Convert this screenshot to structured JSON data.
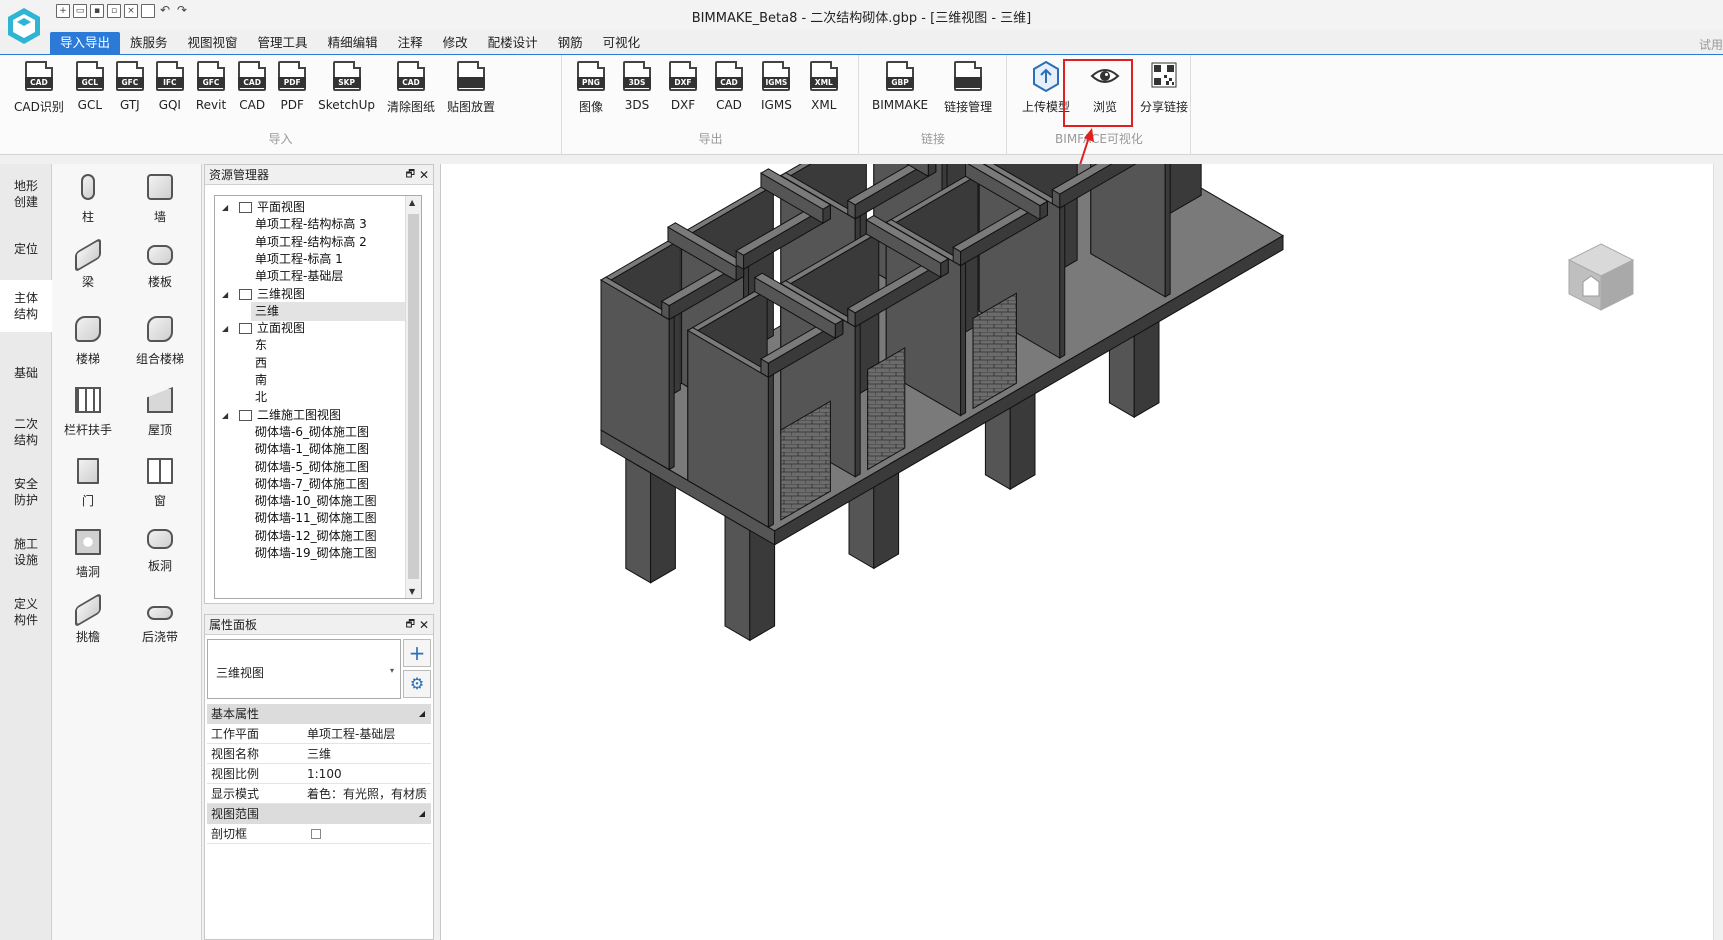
{
  "window": {
    "title": "BIMMAKE_Beta8 - 二次结构砌体.gbp - [三维视图 - 三维]",
    "trial": "试用"
  },
  "ribbon_tabs": [
    "导入导出",
    "族服务",
    "视图视窗",
    "管理工具",
    "精细编辑",
    "注释",
    "修改",
    "配楼设计",
    "钢筋",
    "可视化"
  ],
  "ribbon": {
    "import": {
      "title": "导入",
      "buttons": [
        {
          "label": "CAD识别",
          "tag": "CAD"
        },
        {
          "label": "GCL",
          "tag": "GCL"
        },
        {
          "label": "GTJ",
          "tag": "GFC"
        },
        {
          "label": "GQI",
          "tag": "IFC"
        },
        {
          "label": "Revit",
          "tag": "GFC"
        },
        {
          "label": "CAD",
          "tag": "CAD"
        },
        {
          "label": "PDF",
          "tag": "PDF"
        },
        {
          "label": "SketchUp",
          "tag": "SKP"
        },
        {
          "label": "清除图纸",
          "tag": "CAD"
        },
        {
          "label": "贴图放置",
          "tag": ""
        }
      ]
    },
    "export": {
      "title": "导出",
      "buttons": [
        {
          "label": "图像",
          "tag": "PNG"
        },
        {
          "label": "3DS",
          "tag": "3DS"
        },
        {
          "label": "DXF",
          "tag": "DXF"
        },
        {
          "label": "CAD",
          "tag": "CAD"
        },
        {
          "label": "IGMS",
          "tag": "IGMS"
        },
        {
          "label": "XML",
          "tag": "XML"
        }
      ]
    },
    "link": {
      "title": "链接",
      "buttons": [
        {
          "label": "BIMMAKE",
          "tag": "GBP"
        },
        {
          "label": "链接管理",
          "tag": ""
        }
      ]
    },
    "bimface": {
      "title": "BIMFACE可视化",
      "buttons": [
        {
          "label": "上传模型",
          "tag": ""
        },
        {
          "label": "浏览",
          "tag": ""
        },
        {
          "label": "分享链接",
          "tag": ""
        }
      ]
    }
  },
  "left_rail": [
    "地形创建",
    "定位",
    "主体结构",
    "基础",
    "二次结构",
    "安全防护",
    "施工设施",
    "定义构件"
  ],
  "palette": [
    "柱",
    "墙",
    "梁",
    "楼板",
    "楼梯",
    "组合楼梯",
    "栏杆扶手",
    "屋顶",
    "门",
    "窗",
    "墙洞",
    "板洞",
    "挑檐",
    "后浇带"
  ],
  "resource_manager": {
    "title": "资源管理器",
    "tree": [
      {
        "label": "平面视图",
        "level": 0
      },
      {
        "label": "单项工程-结构标高 3",
        "level": 1
      },
      {
        "label": "单项工程-结构标高 2",
        "level": 1
      },
      {
        "label": "单项工程-标高 1",
        "level": 1
      },
      {
        "label": "单项工程-基础层",
        "level": 1
      },
      {
        "label": "三维视图",
        "level": 0
      },
      {
        "label": "三维",
        "level": 1,
        "selected": true
      },
      {
        "label": "立面视图",
        "level": 0
      },
      {
        "label": "东",
        "level": 1
      },
      {
        "label": "西",
        "level": 1
      },
      {
        "label": "南",
        "level": 1
      },
      {
        "label": "北",
        "level": 1
      },
      {
        "label": "二维施工图视图",
        "level": 0
      },
      {
        "label": "砌体墙-6_砌体施工图",
        "level": 1
      },
      {
        "label": "砌体墙-1_砌体施工图",
        "level": 1
      },
      {
        "label": "砌体墙-5_砌体施工图",
        "level": 1
      },
      {
        "label": "砌体墙-7_砌体施工图",
        "level": 1
      },
      {
        "label": "砌体墙-10_砌体施工图",
        "level": 1
      },
      {
        "label": "砌体墙-11_砌体施工图",
        "level": 1
      },
      {
        "label": "砌体墙-12_砌体施工图",
        "level": 1
      },
      {
        "label": "砌体墙-19_砌体施工图",
        "level": 1
      }
    ]
  },
  "properties": {
    "title": "属性面板",
    "view_type": "三维视图",
    "sections": [
      {
        "name": "基本属性",
        "rows": [
          {
            "key": "工作平面",
            "value": "单项工程-基础层"
          },
          {
            "key": "视图名称",
            "value": "三维"
          },
          {
            "key": "视图比例",
            "value": "1:100"
          },
          {
            "key": "显示模式",
            "value": "着色：有光照，有材质"
          }
        ]
      },
      {
        "name": "视图范围",
        "rows": [
          {
            "key": "剖切框",
            "value": ""
          }
        ]
      }
    ]
  },
  "colors": {
    "accent": "#2b7ad7",
    "highlight": "#e02020",
    "model_dark": "#3a3a3a",
    "model_mid": "#555555",
    "model_light": "#7a7a7a"
  }
}
